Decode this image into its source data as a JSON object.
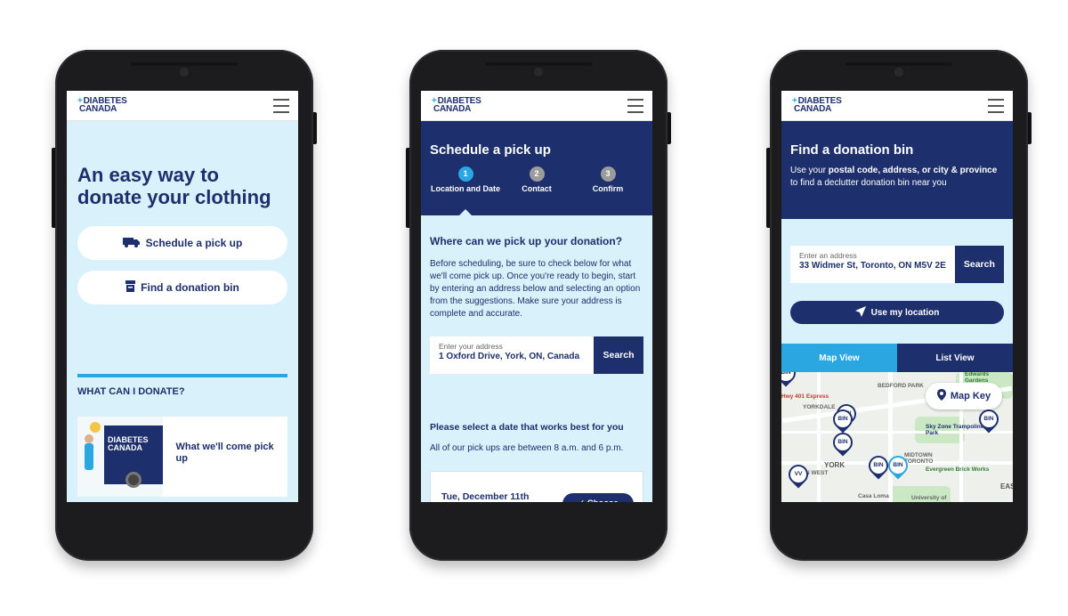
{
  "brand": {
    "logo_line1": "DIABETES",
    "logo_line2": "CANADA",
    "accent": "#2aa6e0",
    "primary": "#1d2f6d",
    "screen_bg": "#d9f1fb"
  },
  "phone1": {
    "hero_title": "An easy way to donate your clothing",
    "schedule_pickup_label": "Schedule a pick up",
    "find_bin_label": "Find a donation bin",
    "what_can_donate": "WHAT CAN I DONATE?",
    "card_text": "What we'll come pick up",
    "card_logo_line1": "DIABETES",
    "card_logo_line2": "CANADA"
  },
  "phone2": {
    "title": "Schedule a pick up",
    "steps": [
      {
        "num": "1",
        "label": "Location and Date"
      },
      {
        "num": "2",
        "label": "Contact"
      },
      {
        "num": "3",
        "label": "Confirm"
      }
    ],
    "question": "Where can we pick up your donation?",
    "paragraph": "Before scheduling, be sure to check below for what we'll come pick up. Once you're ready to begin, start by entering an address below and selecting an option from the suggestions. Make sure your address is complete and accurate.",
    "address_placeholder": "Enter your address",
    "address_value": "1 Oxford Drive, York, ON, Canada",
    "search_label": "Search",
    "date_question": "Please select a date that works best for you",
    "date_note": "All of our pick ups are between 8 a.m. and 6 p.m.",
    "date_value": "Tue, December 11th",
    "choose_label": "✓ Choose"
  },
  "phone3": {
    "title": "Find a donation bin",
    "sub_prefix": "Use your ",
    "sub_bold": "postal code, address, or city & province",
    "sub_suffix": " to find a declutter donation bin near you",
    "address_placeholder": "Enter an address",
    "address_value": "33 Widmer St, Toronto, ON M5V 2E",
    "search_label": "Search",
    "use_location_label": "Use my location",
    "tab_map": "Map View",
    "tab_list": "List View",
    "map_key_label": "Map Key",
    "map_labels": {
      "express": "Hwy 401 Express",
      "bedford": "BEDFORD PARK",
      "yorkdale": "YORKDALE",
      "edwards": "Edwards Gardens",
      "skyzone": "Sky Zone Trampoline Park",
      "york": "YORK",
      "midtown": "MIDTOWN TORONTO",
      "evergreen": "Evergreen Brick Works",
      "casaloma": "Casa Loma",
      "uoft": "University of",
      "west": "ON WEST",
      "east": "EAST"
    },
    "pins": [
      "BIN",
      "BIN",
      "BIN",
      "BIN",
      "BIN",
      "VV",
      "BIN",
      "BIN"
    ]
  }
}
